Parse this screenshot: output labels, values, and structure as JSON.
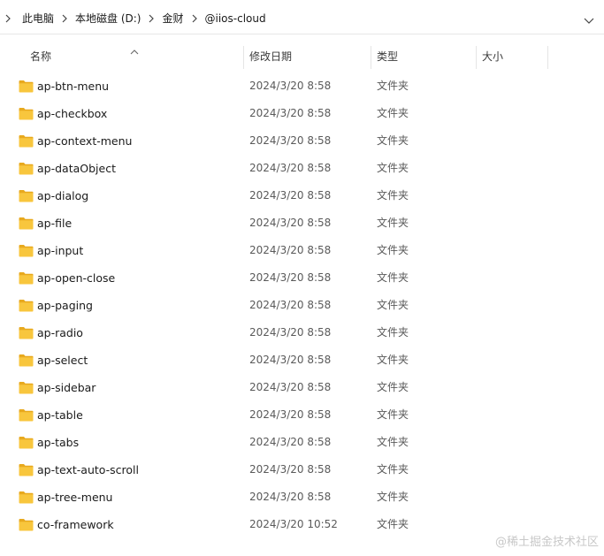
{
  "breadcrumb": {
    "items": [
      "此电脑",
      "本地磁盘 (D:)",
      "金财",
      "@iios-cloud"
    ]
  },
  "columns": {
    "name": "名称",
    "date": "修改日期",
    "type": "类型",
    "size": "大小"
  },
  "files": [
    {
      "name": "ap-btn-menu",
      "date": "2024/3/20 8:58",
      "type": "文件夹"
    },
    {
      "name": "ap-checkbox",
      "date": "2024/3/20 8:58",
      "type": "文件夹"
    },
    {
      "name": "ap-context-menu",
      "date": "2024/3/20 8:58",
      "type": "文件夹"
    },
    {
      "name": "ap-dataObject",
      "date": "2024/3/20 8:58",
      "type": "文件夹"
    },
    {
      "name": "ap-dialog",
      "date": "2024/3/20 8:58",
      "type": "文件夹"
    },
    {
      "name": "ap-file",
      "date": "2024/3/20 8:58",
      "type": "文件夹"
    },
    {
      "name": "ap-input",
      "date": "2024/3/20 8:58",
      "type": "文件夹"
    },
    {
      "name": "ap-open-close",
      "date": "2024/3/20 8:58",
      "type": "文件夹"
    },
    {
      "name": "ap-paging",
      "date": "2024/3/20 8:58",
      "type": "文件夹"
    },
    {
      "name": "ap-radio",
      "date": "2024/3/20 8:58",
      "type": "文件夹"
    },
    {
      "name": "ap-select",
      "date": "2024/3/20 8:58",
      "type": "文件夹"
    },
    {
      "name": "ap-sidebar",
      "date": "2024/3/20 8:58",
      "type": "文件夹"
    },
    {
      "name": "ap-table",
      "date": "2024/3/20 8:58",
      "type": "文件夹"
    },
    {
      "name": "ap-tabs",
      "date": "2024/3/20 8:58",
      "type": "文件夹"
    },
    {
      "name": "ap-text-auto-scroll",
      "date": "2024/3/20 8:58",
      "type": "文件夹"
    },
    {
      "name": "ap-tree-menu",
      "date": "2024/3/20 8:58",
      "type": "文件夹"
    },
    {
      "name": "co-framework",
      "date": "2024/3/20 10:52",
      "type": "文件夹"
    }
  ],
  "watermark": "@稀土掘金技术社区",
  "colors": {
    "folder_body": "#f8c63d",
    "folder_tab": "#e8a91e",
    "text_muted": "#5a5a5a"
  }
}
